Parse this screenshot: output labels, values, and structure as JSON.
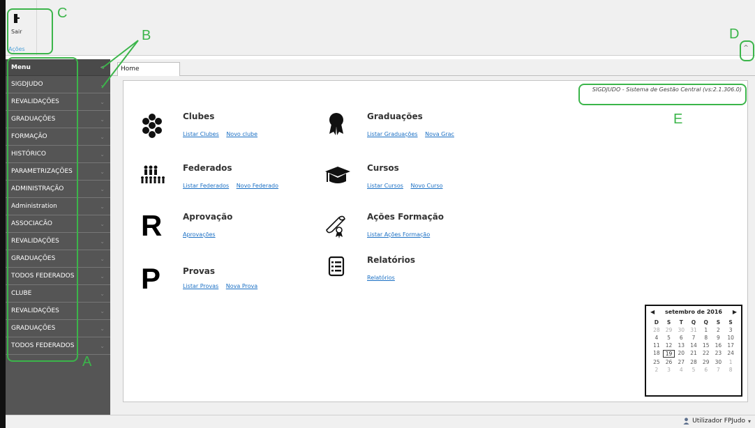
{
  "ribbon": {
    "exit_label": "Sair",
    "group_label": "Ações",
    "collapse_glyph": "^"
  },
  "sidebar": {
    "header": "Menu",
    "header_chevron": "<",
    "items": [
      {
        "label": "SIGDJUDO"
      },
      {
        "label": "REVALIDAÇÕES"
      },
      {
        "label": "GRADUAÇÕES"
      },
      {
        "label": "FORMAÇÃO"
      },
      {
        "label": "HISTÓRICO"
      },
      {
        "label": "PARAMETRIZAÇÕES"
      },
      {
        "label": "ADMINISTRAÇÃO"
      },
      {
        "label": "Administration"
      },
      {
        "label": "ASSOCIACÃO"
      },
      {
        "label": "REVALIDAÇÕES"
      },
      {
        "label": "GRADUAÇÕES"
      },
      {
        "label": "TODOS FEDERADOS"
      },
      {
        "label": "CLUBE"
      },
      {
        "label": "REVALIDAÇÕES"
      },
      {
        "label": "GRADUAÇÕES"
      },
      {
        "label": "TODOS FEDERADOS"
      }
    ],
    "item_chevron": "⌄"
  },
  "tabs": {
    "home": "Home"
  },
  "version": "SIGDJUDO - Sistema de Gestão Central  (vs:2.1.306.0)",
  "modules": {
    "clubes": {
      "title": "Clubes",
      "links": [
        "Listar Clubes",
        "Novo clube"
      ],
      "icon": "flower-icon"
    },
    "graduacoes": {
      "title": "Graduações",
      "links": [
        "Listar Graduações",
        "Nova Grac"
      ],
      "icon": "award-icon"
    },
    "federados": {
      "title": "Federados",
      "links": [
        "Listar Federados",
        "Novo Federado"
      ],
      "icon": "people-group-icon"
    },
    "cursos": {
      "title": "Cursos",
      "links": [
        "Listar Cursos",
        "Novo Curso"
      ],
      "icon": "graduation-cap-icon"
    },
    "aprovacao": {
      "title": "Aprovação",
      "links": [
        "Aprovações"
      ],
      "icon": "letter-r-icon",
      "glyph": "R"
    },
    "acoes": {
      "title": "Ações Formação",
      "links": [
        "Listar Ações Formação"
      ],
      "icon": "diploma-scroll-icon"
    },
    "provas": {
      "title": "Provas",
      "links": [
        "Listar Provas",
        "Nova Prova"
      ],
      "icon": "letter-p-icon",
      "glyph": "P"
    },
    "relatorios": {
      "title": "Relatórios",
      "links": [
        "Relatórios"
      ],
      "icon": "report-list-icon"
    }
  },
  "calendar": {
    "title": "setembro de 2016",
    "prev": "◀",
    "next": "▶",
    "dow": [
      "D",
      "S",
      "T",
      "Q",
      "Q",
      "S",
      "S"
    ],
    "weeks": [
      [
        "28",
        "29",
        "30",
        "31",
        "1",
        "2",
        "3"
      ],
      [
        "4",
        "5",
        "6",
        "7",
        "8",
        "9",
        "10"
      ],
      [
        "11",
        "12",
        "13",
        "14",
        "15",
        "16",
        "17"
      ],
      [
        "18",
        "19",
        "20",
        "21",
        "22",
        "23",
        "24"
      ],
      [
        "25",
        "26",
        "27",
        "28",
        "29",
        "30",
        "1"
      ],
      [
        "2",
        "3",
        "4",
        "5",
        "6",
        "7",
        "8"
      ]
    ],
    "selected_day": "19"
  },
  "status": {
    "user_label": "Utilizador FPJudo",
    "user_caret": "▾"
  },
  "annotations": {
    "A": "A",
    "B": "B",
    "C": "C",
    "D": "D",
    "E": "E",
    "color": "#3bb54a"
  }
}
